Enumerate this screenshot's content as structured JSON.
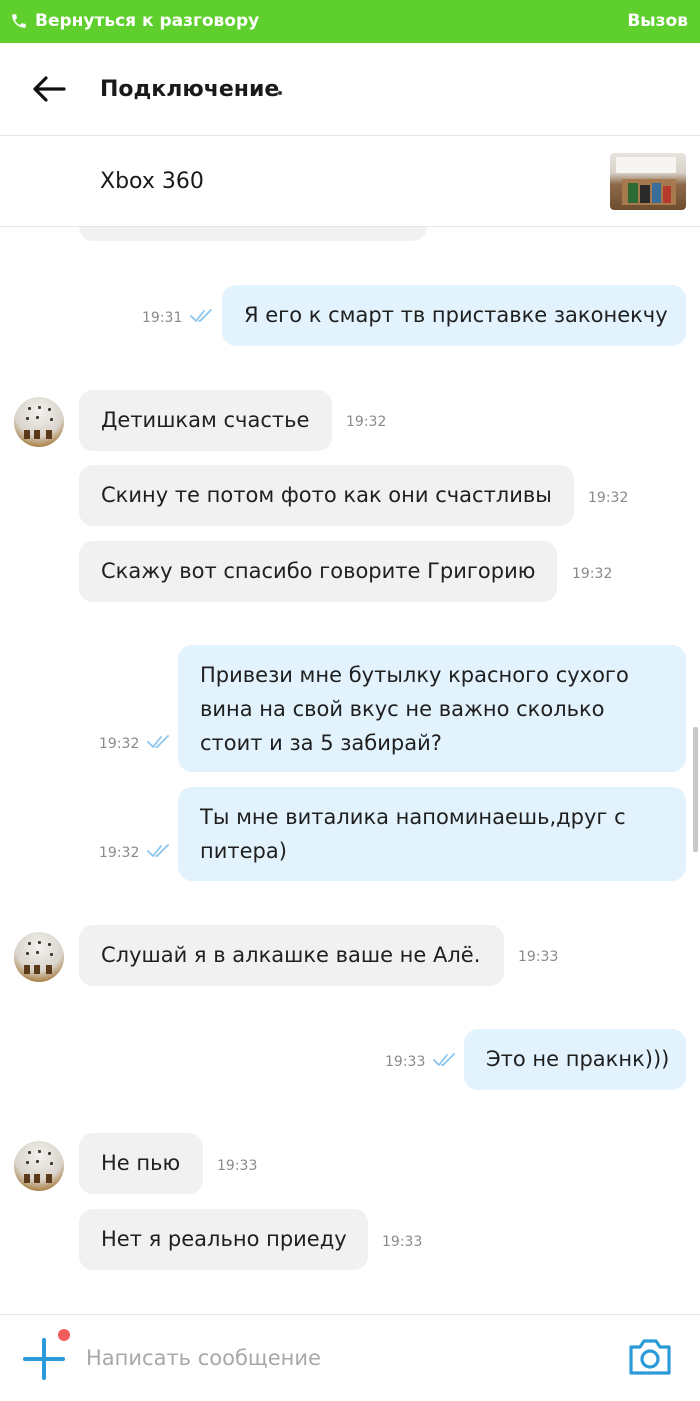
{
  "callbar": {
    "back_label": "Вернуться к разговору",
    "call_label": "Вызов",
    "color": "#5fcf2e"
  },
  "header": {
    "title": "Подключение"
  },
  "listing": {
    "name": "Xbox 360"
  },
  "messages": [
    {
      "side": "out",
      "text": "Я его к смарт тв приставке законекчу",
      "time": "19:31",
      "read": true
    },
    {
      "side": "in",
      "text": "Детишкам счастье",
      "time": "19:32"
    },
    {
      "side": "in",
      "text": "Скину те потом фото как они счастливы",
      "time": "19:32"
    },
    {
      "side": "in",
      "text": "Скажу вот спасибо говорите Григорию",
      "time": "19:32"
    },
    {
      "side": "out",
      "lines": [
        "Привези мне бутылку красного сухого",
        "вина на свой вкус не важно сколько",
        "стоит и за 5 забирай?"
      ],
      "time": "19:32",
      "read": true
    },
    {
      "side": "out",
      "lines": [
        "Ты мне виталика напоминаешь,друг с",
        "питера)"
      ],
      "time": "19:32",
      "read": true
    },
    {
      "side": "in",
      "text": "Слушай я в алкашке ваше не Алё.",
      "time": "19:33"
    },
    {
      "side": "out",
      "text": "Это не пракнк)))",
      "time": "19:33",
      "read": true
    },
    {
      "side": "in",
      "text": "Не пью",
      "time": "19:33"
    },
    {
      "side": "in",
      "text": "Нет я реально приеду",
      "time": "19:33"
    }
  ],
  "input": {
    "placeholder": "Написать сообщение"
  },
  "icons": {
    "phone": "phone-icon",
    "back": "back-arrow-icon",
    "ticks": "double-check-icon",
    "plus": "plus-icon",
    "camera": "camera-icon"
  },
  "colors": {
    "accent": "#2a9bd8",
    "outgoing_bubble": "#e2f3fd",
    "incoming_bubble": "#f1f1f1",
    "notification_dot": "#f25d5d"
  }
}
